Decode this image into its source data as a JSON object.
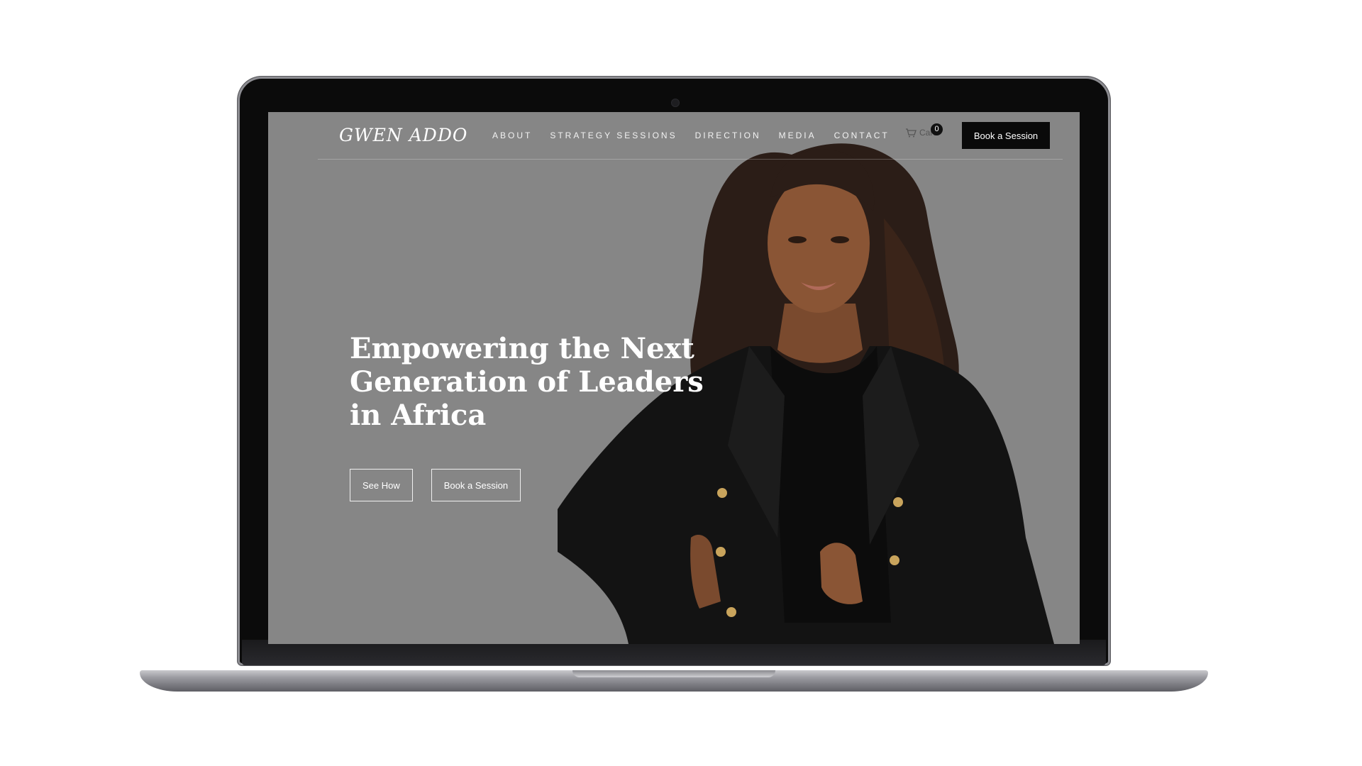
{
  "site": {
    "logo": "GWEN ADDO",
    "nav": [
      "ABOUT",
      "STRATEGY SESSIONS",
      "DIRECTION",
      "MEDIA",
      "CONTACT"
    ],
    "cart": {
      "label": "Cart",
      "count": "0"
    },
    "header_cta": "Book a Session"
  },
  "hero": {
    "title_lines": [
      "Empowering the Next",
      "Generation of Leaders",
      "in Africa"
    ],
    "buttons": [
      "See How",
      "Book a Session"
    ],
    "background_color": "#868686"
  },
  "icons": {
    "cart": "cart-icon",
    "camera": "camera-icon"
  },
  "colors": {
    "cta_bg": "#0a0a0a",
    "text_light": "#ffffff",
    "laptop_frame": "#0b0b0b"
  }
}
